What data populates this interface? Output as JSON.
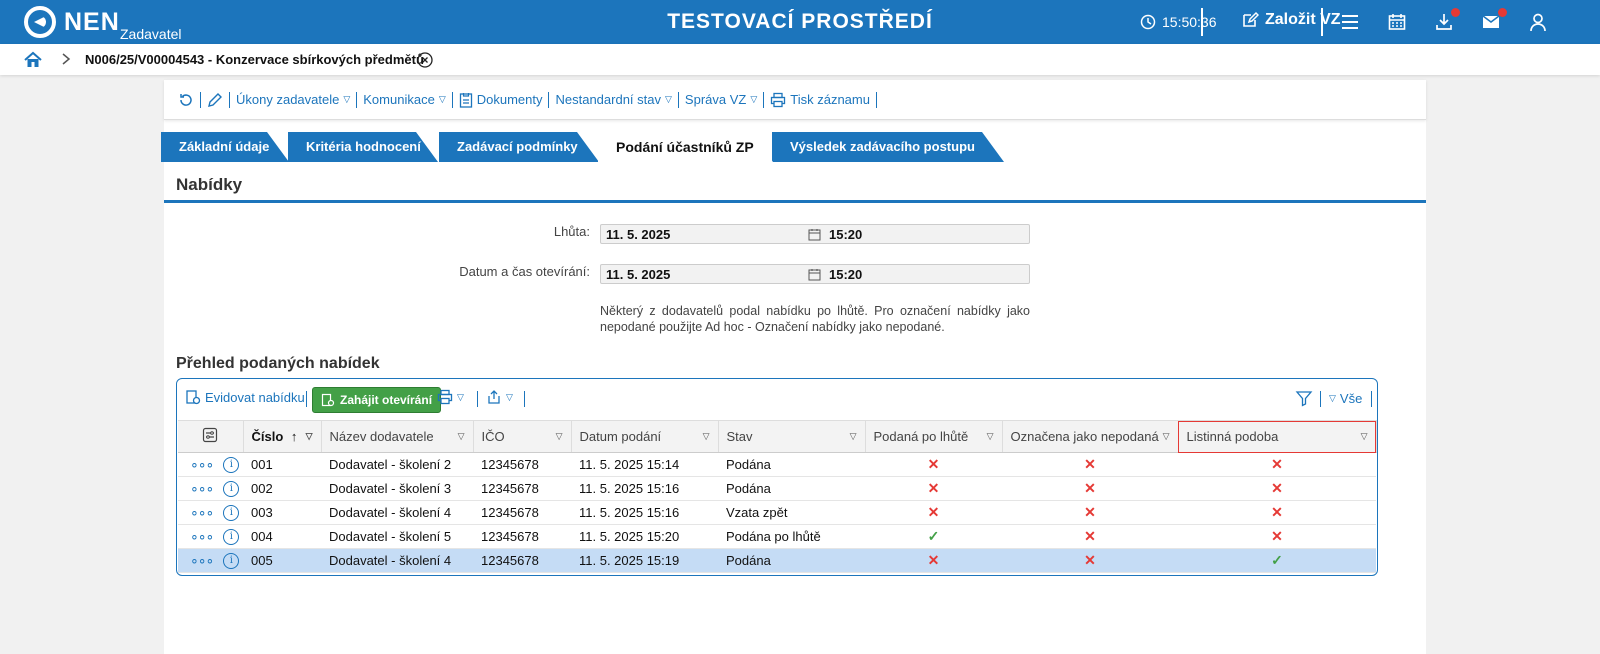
{
  "header": {
    "logo": "NEN",
    "logo_sub": "Zadavatel",
    "env_title": "TESTOVACÍ PROSTŘEDÍ",
    "clock": "15:50:36",
    "new_vz_label": "Založit VZ",
    "icons": [
      "clock-icon",
      "edit-icon",
      "menu-icon",
      "calendar-icon",
      "download-icon",
      "mail-icon",
      "user-icon"
    ],
    "accent": "#1c75bc"
  },
  "breadcrumb": {
    "text": "N006/25/V00004543 - Konzervace sbírkových předmětů"
  },
  "toolbar": {
    "items": [
      {
        "label": ""
      },
      {
        "label": ""
      },
      {
        "label": "Úkony zadavatele",
        "caret": "▽"
      },
      {
        "label": "Komunikace",
        "caret": "▽"
      },
      {
        "label": "Dokumenty"
      },
      {
        "label": "Nestandardní stav",
        "caret": "▽"
      },
      {
        "label": "Správa VZ",
        "caret": "▽"
      },
      {
        "label": "Tisk záznamu"
      }
    ]
  },
  "tabs": [
    {
      "label": "Základní údaje"
    },
    {
      "label": "Kritéria hodnocení"
    },
    {
      "label": "Zadávací podmínky"
    },
    {
      "label": "Podání účastníků ZP",
      "active": true
    },
    {
      "label": "Výsledek zadávacího postupu"
    }
  ],
  "section": {
    "title": "Nabídky"
  },
  "fields": {
    "deadline": {
      "label": "Lhůta:",
      "date": "11. 5. 2025",
      "time": "15:20"
    },
    "opening": {
      "label": "Datum a čas otevírání:",
      "date": "11. 5. 2025",
      "time": "15:20"
    },
    "notice": "Některý z dodavatelů podal nabídku po lhůtě. Pro označení nabídky jako nepodané použijte Ad hoc - Označení nabídky jako nepodané."
  },
  "list": {
    "title": "Přehled podaných nabídek",
    "toolbar": {
      "record_label": "Evidovat nabídku",
      "open_label": "Zahájit otevírání",
      "filter_label": "Vše",
      "caret": "▽"
    },
    "columns": {
      "cislo": "Číslo",
      "sort_arrow": "↑",
      "nazev": "Název dodavatele",
      "ico": "IČO",
      "datum": "Datum podání",
      "stav": "Stav",
      "po_lhute": "Podaná po lhůtě",
      "nepodana": "Označena jako nepodaná",
      "listinna": "Listinná podoba"
    },
    "rows": [
      {
        "cislo": "001",
        "nazev": "Dodavatel - školení 2",
        "ico": "12345678",
        "datum": "11. 5. 2025 15:14",
        "stav": "Podána",
        "po_lhute": "✕",
        "nepodana": "✕",
        "listinna": "✕"
      },
      {
        "cislo": "002",
        "nazev": "Dodavatel - školení 3",
        "ico": "12345678",
        "datum": "11. 5. 2025 15:16",
        "stav": "Podána",
        "po_lhute": "✕",
        "nepodana": "✕",
        "listinna": "✕"
      },
      {
        "cislo": "003",
        "nazev": "Dodavatel - školení 4",
        "ico": "12345678",
        "datum": "11. 5. 2025 15:16",
        "stav": "Vzata zpět",
        "po_lhute": "✕",
        "nepodana": "✕",
        "listinna": "✕"
      },
      {
        "cislo": "004",
        "nazev": "Dodavatel - školení 5",
        "ico": "12345678",
        "datum": "11. 5. 2025 15:20",
        "stav": "Podána po lhůtě",
        "po_lhute": "✓",
        "nepodana": "✕",
        "listinna": "✕"
      },
      {
        "cislo": "005",
        "nazev": "Dodavatel - školení 4",
        "ico": "12345678",
        "datum": "11. 5. 2025 15:19",
        "stav": "Podána",
        "po_lhute": "✕",
        "nepodana": "✕",
        "listinna": "✓",
        "selected": true
      }
    ],
    "row_action_dots": "∘∘∘",
    "row_action_info": "i"
  }
}
